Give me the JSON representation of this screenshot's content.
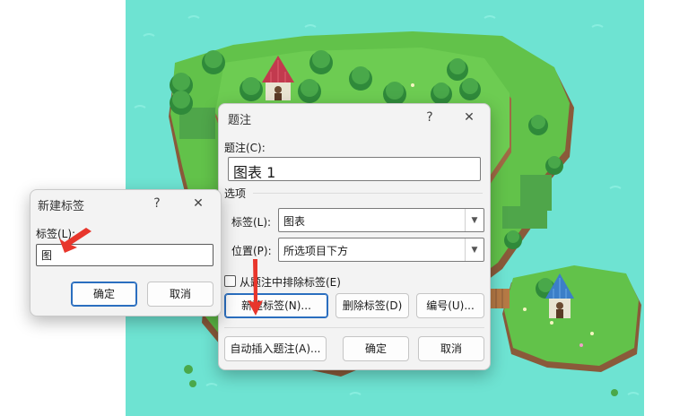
{
  "caption_dialog": {
    "title": "题注",
    "help_icon": "?",
    "close_icon": "✕",
    "caption_label": "题注(C):",
    "caption_value": "图表 1",
    "options_label": "选项",
    "label_label": "标签(L):",
    "label_value": "图表",
    "position_label": "位置(P):",
    "position_value": "所选项目下方",
    "exclude_label": "从题注中排除标签(E)",
    "new_label_button": "新建标签(N)...",
    "delete_label_button": "删除标签(D)",
    "numbering_button": "编号(U)...",
    "autocaption_button": "自动插入题注(A)...",
    "ok_button": "确定",
    "cancel_button": "取消"
  },
  "new_label_dialog": {
    "title": "新建标签",
    "help_icon": "?",
    "close_icon": "✕",
    "label_label": "标签(L):",
    "label_value": "图",
    "ok_button": "确定",
    "cancel_button": "取消"
  },
  "colors": {
    "water": "#6ee3d2",
    "grass": "#62c24a",
    "arrow": "#e8362c",
    "accent": "#2a6ebf"
  }
}
